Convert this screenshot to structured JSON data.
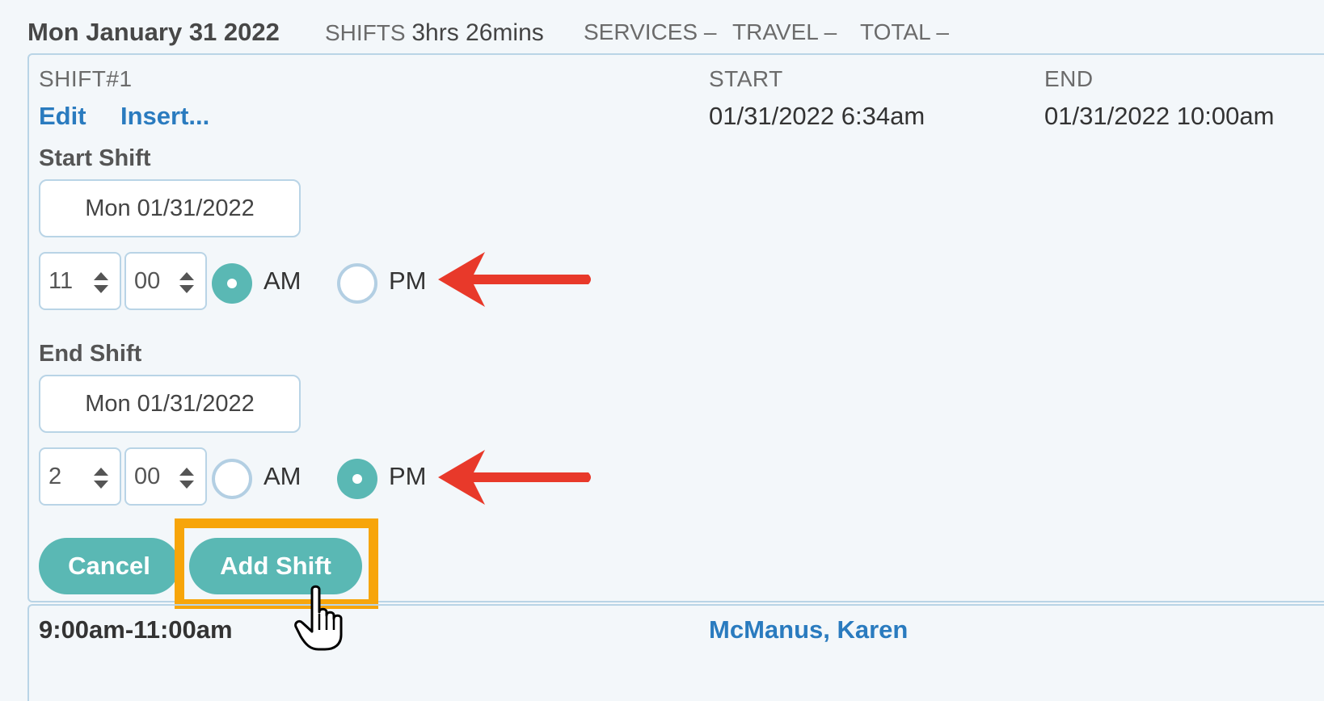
{
  "header": {
    "date": "Mon January 31 2022",
    "shifts_label": "SHIFTS",
    "shifts_value": "3hrs 26mins",
    "services_label": "SERVICES",
    "services_value": "–",
    "travel_label": "TRAVEL",
    "travel_value": "–",
    "total_label": "TOTAL",
    "total_value": "–"
  },
  "shift": {
    "id_label": "SHIFT#1",
    "edit_link": "Edit",
    "insert_link": "Insert...",
    "start_header": "START",
    "end_header": "END",
    "start_value": "01/31/2022 6:34am",
    "end_value": "01/31/2022 10:00am"
  },
  "form": {
    "start_label": "Start Shift",
    "start_date": "Mon 01/31/2022",
    "start_hour": "11",
    "start_minute": "00",
    "start_meridiem_selected": "AM",
    "end_label": "End Shift",
    "end_date": "Mon 01/31/2022",
    "end_hour": "2",
    "end_minute": "00",
    "end_meridiem_selected": "PM",
    "am_label": "AM",
    "pm_label": "PM",
    "cancel_label": "Cancel",
    "add_label": "Add Shift"
  },
  "next_row": {
    "time": "9:00am-11:00am",
    "client": "McManus, Karen"
  },
  "colors": {
    "accent": "#5ab8b4",
    "link": "#2a7bbf",
    "highlight": "#f7a50a",
    "arrow": "#e8392a"
  }
}
